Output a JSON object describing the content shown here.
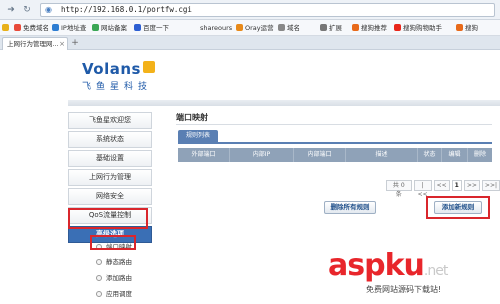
{
  "browser": {
    "url": "http://192.168.0.1/portfw.cgi",
    "tab_title": "上网行为管理网...",
    "favorites": [
      {
        "label": "免费域名",
        "color": "#e84a3a"
      },
      {
        "label": "IP地址查",
        "color": "#2d7dd2"
      },
      {
        "label": "网站备案",
        "color": "#3aa655"
      },
      {
        "label": "百度一下",
        "color": "#2d5fd2"
      },
      {
        "label": "shareours",
        "color": "#999999"
      },
      {
        "label": "Oray运营",
        "color": "#e88a1a"
      },
      {
        "label": "域名",
        "color": "#888888"
      },
      {
        "label": "扩展",
        "color": "#777777"
      },
      {
        "label": "搜狗推荐",
        "color": "#e86a1a"
      },
      {
        "label": "搜狗购物助手",
        "color": "#e8261a"
      },
      {
        "label": "搜狗",
        "color": "#e86a1a"
      }
    ]
  },
  "logo": {
    "word": "Volans",
    "cn": "飞鱼星科技"
  },
  "sidebar": {
    "items": [
      {
        "label": "飞鱼星欢迎您",
        "active": false
      },
      {
        "label": "系统状态",
        "active": false
      },
      {
        "label": "基础设置",
        "active": false
      },
      {
        "label": "上网行为管理",
        "active": false
      },
      {
        "label": "网络安全",
        "active": false
      },
      {
        "label": "QoS流量控制",
        "active": false
      },
      {
        "label": "高级选项",
        "active": true
      }
    ],
    "subitems": [
      "端口映射",
      "静态路由",
      "添加路由",
      "应用调度"
    ]
  },
  "main": {
    "title": "端口映射",
    "subtab": "规则列表",
    "columns": [
      "外部端口",
      "内部IP",
      "内部端口",
      "描述",
      "状态",
      "编辑",
      "删除"
    ]
  },
  "pager": {
    "total": "共 0 条",
    "first": "|<<",
    "prev": "<<",
    "page": "1",
    "next": ">>",
    "last": ">>|"
  },
  "buttons": {
    "delete_all": "删除所有规则",
    "add_new": "添加新规则"
  },
  "watermark": {
    "brand_a": "asp",
    "brand_b": "ku",
    "net": ".net",
    "sub": "免费网站源码下载站!"
  },
  "colors": {
    "accent_blue": "#3a6fb5",
    "highlight_red": "#d9262c"
  }
}
